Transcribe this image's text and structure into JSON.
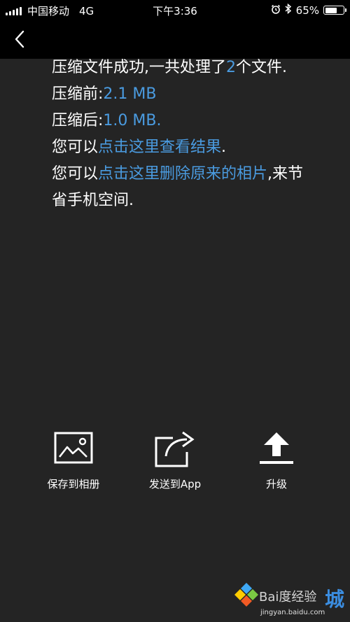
{
  "status_bar": {
    "carrier": "中国移动",
    "network": "4G",
    "time": "下午3:36",
    "battery_text": "65%",
    "battery_level": 0.65,
    "alarm_icon": "alarm-icon",
    "bluetooth_icon": "bluetooth-icon"
  },
  "nav": {
    "back_icon": "back-chevron-icon"
  },
  "result": {
    "line1_prefix": "压缩文件成功,一共处理了",
    "count": "2",
    "line1_suffix": "个文件.",
    "before_label": "压缩前:",
    "before_value": "2.1 MB",
    "after_label": "压缩后:",
    "after_value": "1.0 MB.",
    "view_prefix": "您可以",
    "view_link": "点击这里查看结果",
    "view_suffix": ".",
    "delete_prefix": "您可以",
    "delete_link": "点击这里删除原来的相片",
    "delete_suffix": ",来节省手机空间."
  },
  "actions": [
    {
      "label": "保存到相册",
      "icon": "image-icon"
    },
    {
      "label": "发送到App",
      "icon": "share-icon"
    },
    {
      "label": "升级",
      "icon": "upload-icon"
    }
  ],
  "watermark": {
    "text": "Bai度经验",
    "big_char": "城",
    "sub": "jingyan.baidu.com"
  },
  "colors": {
    "background": "#242424",
    "bar": "#000000",
    "accent": "#4a9be0",
    "text": "#ffffff"
  }
}
